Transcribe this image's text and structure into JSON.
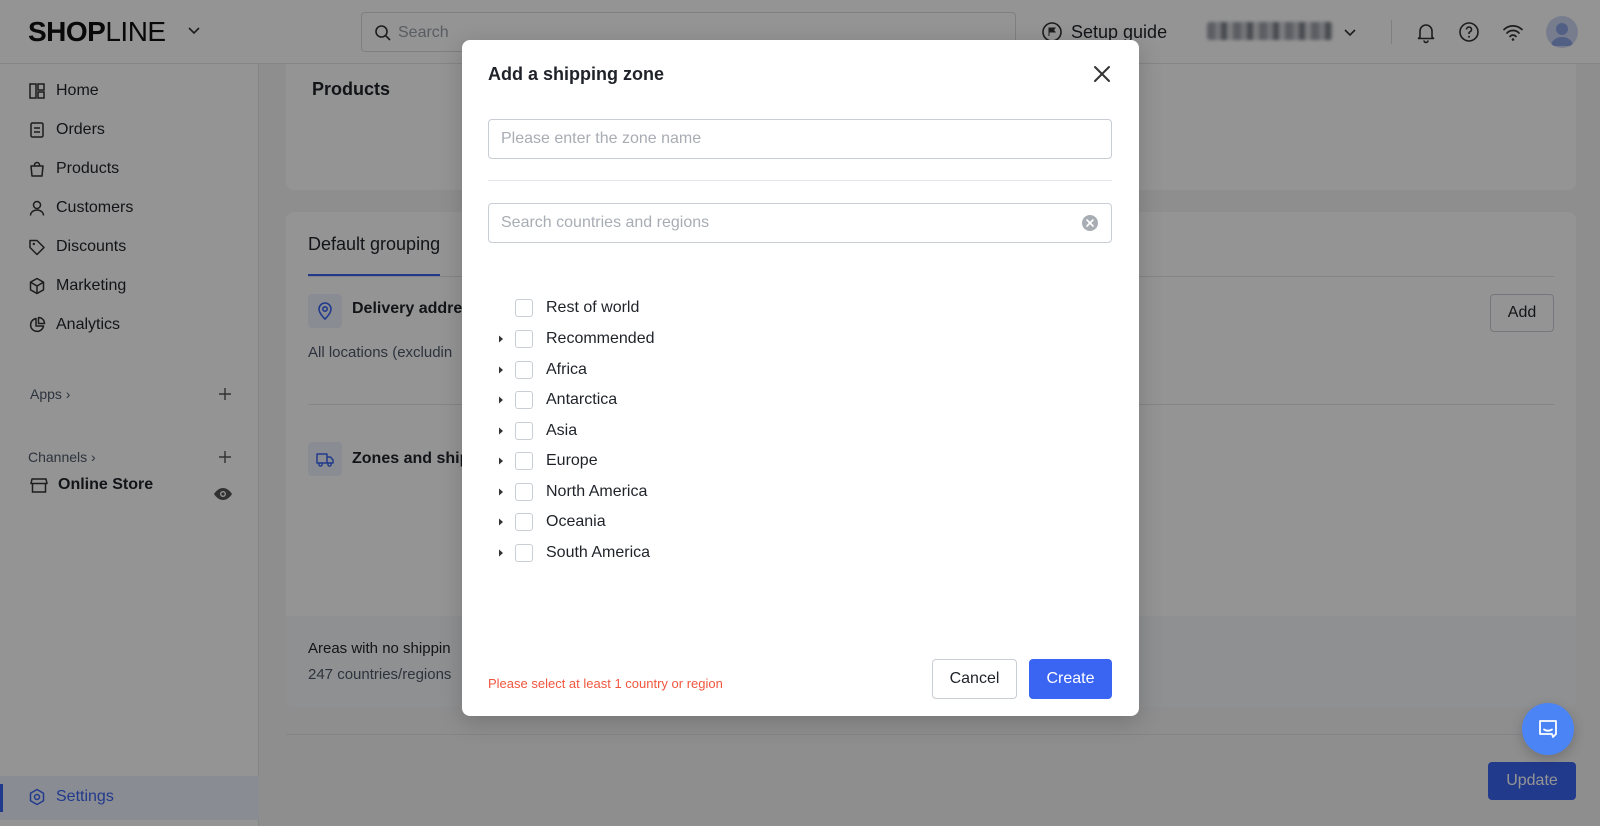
{
  "topbar": {
    "logo_bold": "SHOP",
    "logo_light": "LINE",
    "search_placeholder": "Search",
    "setup_guide": "Setup guide"
  },
  "sidebar": {
    "items": [
      {
        "label": "Home",
        "icon": "home-icon"
      },
      {
        "label": "Orders",
        "icon": "orders-icon"
      },
      {
        "label": "Products",
        "icon": "products-icon"
      },
      {
        "label": "Customers",
        "icon": "customers-icon"
      },
      {
        "label": "Discounts",
        "icon": "discounts-icon"
      },
      {
        "label": "Marketing",
        "icon": "marketing-icon"
      },
      {
        "label": "Analytics",
        "icon": "analytics-icon"
      }
    ],
    "apps_label": "Apps",
    "channels_label": "Channels",
    "online_store": "Online Store",
    "settings": "Settings"
  },
  "background": {
    "products_title": "Products",
    "tab_default_grouping": "Default grouping",
    "delivery_address": "Delivery addres",
    "all_locations": "All locations (excludin",
    "add_button": "Add",
    "zones_and_shipping": "Zones and ship",
    "areas_no_shipping": "Areas with no shippin",
    "countries_count": "247 countries/regions",
    "update_button": "Update"
  },
  "modal": {
    "title": "Add a shipping zone",
    "zone_name_placeholder": "Please enter the zone name",
    "zone_name_value": "",
    "region_search_placeholder": "Search countries and regions",
    "regions": [
      {
        "label": "Rest of world",
        "expandable": false,
        "checked": false
      },
      {
        "label": "Recommended",
        "expandable": true,
        "checked": false
      },
      {
        "label": "Africa",
        "expandable": true,
        "checked": false
      },
      {
        "label": "Antarctica",
        "expandable": true,
        "checked": false
      },
      {
        "label": "Asia",
        "expandable": true,
        "checked": false
      },
      {
        "label": "Europe",
        "expandable": true,
        "checked": false
      },
      {
        "label": "North America",
        "expandable": true,
        "checked": false
      },
      {
        "label": "Oceania",
        "expandable": true,
        "checked": false
      },
      {
        "label": "South America",
        "expandable": true,
        "checked": false
      }
    ],
    "error_message": "Please select at least 1 country or region",
    "cancel": "Cancel",
    "create": "Create"
  },
  "colors": {
    "accent": "#3a64f2",
    "error": "#f0563e",
    "chat": "#4a84f5"
  }
}
